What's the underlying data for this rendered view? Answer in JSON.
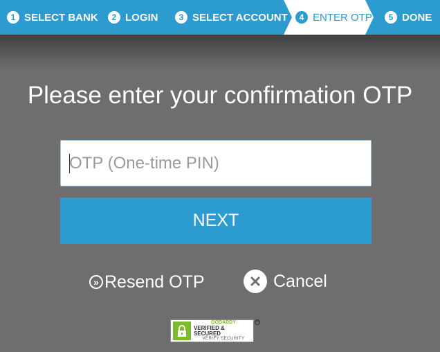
{
  "steps": [
    {
      "num": "1",
      "label": "SELECT BANK"
    },
    {
      "num": "2",
      "label": "LOGIN"
    },
    {
      "num": "3",
      "label": "SELECT ACCOUNT"
    },
    {
      "num": "4",
      "label": "ENTER OTP"
    },
    {
      "num": "5",
      "label": "DONE"
    }
  ],
  "colors": {
    "accent": "#2b9bd0",
    "background": "#6e6e6e",
    "badge_green": "#7dba2f"
  },
  "heading": "Please enter your confirmation OTP",
  "otp": {
    "placeholder": "OTP (One-time PIN)",
    "value": ""
  },
  "next_label": "NEXT",
  "resend": {
    "icon": "double-chevron-right-circle-icon",
    "label": "Resend OTP"
  },
  "cancel": {
    "icon": "close-circle-icon",
    "label": "Cancel"
  },
  "badge": {
    "line1": "GODADDY",
    "line2": "VERIFIED & SECURED",
    "line3": "VERIFY SECURITY",
    "icon": "lock-icon"
  },
  "badge_reg": "R"
}
